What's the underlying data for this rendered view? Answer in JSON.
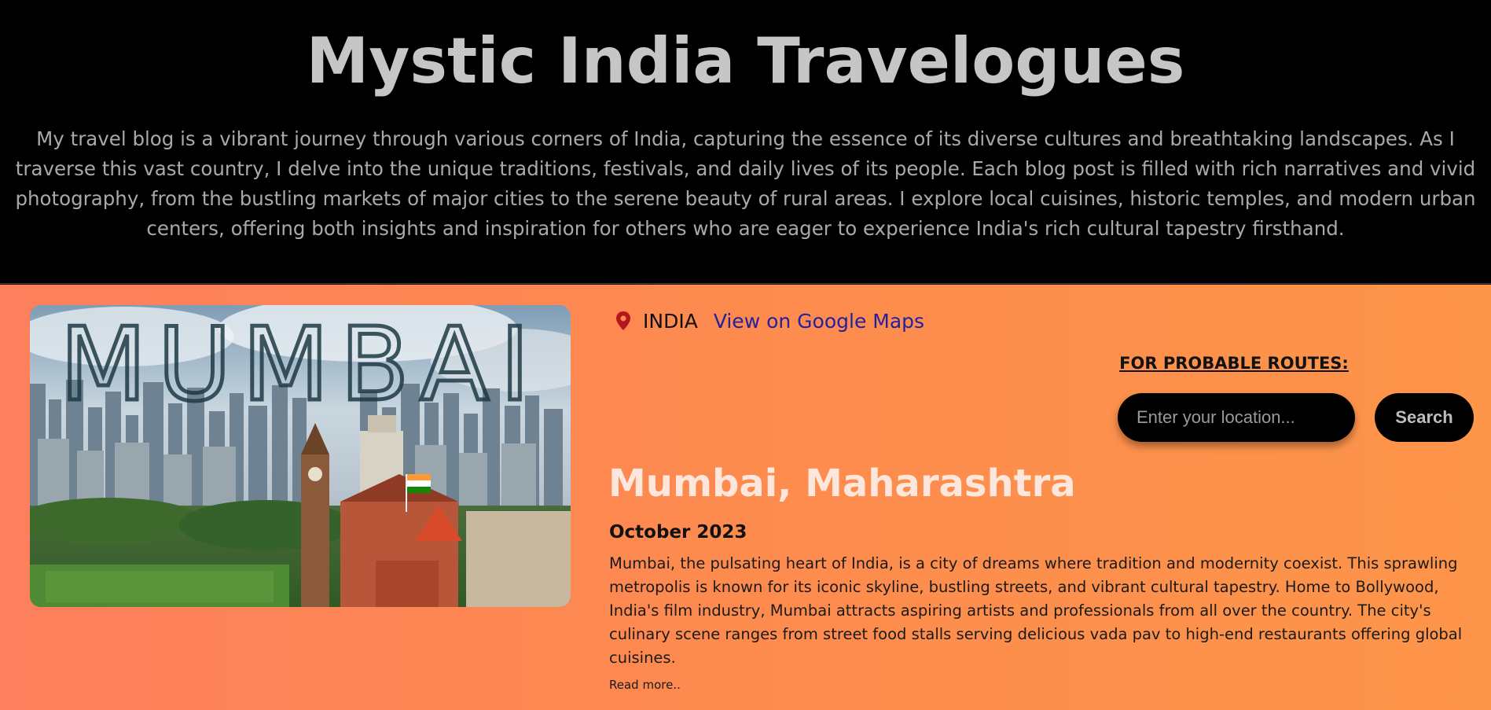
{
  "header": {
    "title": "Mystic India Travelogues",
    "intro": "My travel blog is a vibrant journey through various corners of India, capturing the essence of its diverse cultures and breathtaking landscapes. As I traverse this vast country, I delve into the unique traditions, festivals, and daily lives of its people. Each blog post is filled with rich narratives and vivid photography, from the bustling markets of major cities to the serene beauty of rural areas. I explore local cuisines, historic temples, and modern urban centers, offering both insights and inspiration for others who are eager to experience India's rich cultural tapestry firsthand."
  },
  "post": {
    "image_text": "MUMBAI",
    "location_icon": "map-pin-icon",
    "country": "INDIA",
    "maps_link": "View on Google Maps",
    "routes_label": "FOR PROBABLE ROUTES:",
    "location_placeholder": "Enter your location...",
    "search_label": "Search",
    "title": "Mumbai, Maharashtra",
    "date": "October 2023",
    "body": "Mumbai, the pulsating heart of India, is a city of dreams where tradition and modernity coexist. This sprawling metropolis is known for its iconic skyline, bustling streets, and vibrant cultural tapestry. Home to Bollywood, India's film industry, Mumbai attracts aspiring artists and professionals from all over the country. The city's culinary scene ranges from street food stalls serving delicious vada pav to high-end restaurants offering global cuisines.",
    "read_more": "Read more.."
  },
  "colors": {
    "accent_gradient_start": "#fd7f5d",
    "accent_gradient_end": "#fd954a",
    "link": "#2420a0",
    "pin": "#b3161b"
  }
}
